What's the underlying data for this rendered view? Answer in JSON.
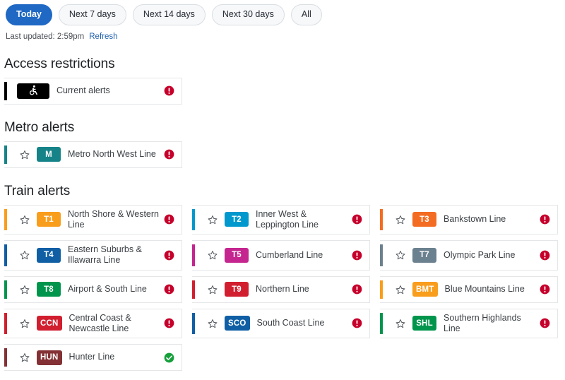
{
  "filters": {
    "items": [
      {
        "label": "Today",
        "active": true
      },
      {
        "label": "Next 7 days",
        "active": false
      },
      {
        "label": "Next 14 days",
        "active": false
      },
      {
        "label": "Next 30 days",
        "active": false
      },
      {
        "label": "All",
        "active": false
      }
    ]
  },
  "updated": {
    "text": "Last updated: 2:59pm",
    "refresh_label": "Refresh"
  },
  "sections": [
    {
      "title": "Access restrictions",
      "layout": "single",
      "items": [
        {
          "badge": "",
          "badge_icon": "wheelchair-icon",
          "label": "Current alerts",
          "color": "#000000",
          "status": "alert",
          "star": false
        }
      ]
    },
    {
      "title": "Metro alerts",
      "layout": "single",
      "items": [
        {
          "badge": "M",
          "label": "Metro North West Line",
          "color": "#168388",
          "status": "alert",
          "star": true
        }
      ]
    },
    {
      "title": "Train alerts",
      "layout": "grid",
      "items": [
        {
          "badge": "T1",
          "label": "North Shore & Western Line",
          "color": "#f99d1c",
          "status": "alert",
          "star": true
        },
        {
          "badge": "T2",
          "label": "Inner West & Leppington Line",
          "color": "#0098cd",
          "status": "alert",
          "star": true
        },
        {
          "badge": "T3",
          "label": "Bankstown Line",
          "color": "#f36c21",
          "status": "alert",
          "star": true
        },
        {
          "badge": "T4",
          "label": "Eastern Suburbs & Illawarra Line",
          "color": "#105fa5",
          "status": "alert",
          "star": true
        },
        {
          "badge": "T5",
          "label": "Cumberland Line",
          "color": "#c4258f",
          "status": "alert",
          "star": true
        },
        {
          "badge": "T7",
          "label": "Olympic Park Line",
          "color": "#6c818f",
          "status": "alert",
          "star": true
        },
        {
          "badge": "T8",
          "label": "Airport & South Line",
          "color": "#00954c",
          "status": "alert",
          "star": true
        },
        {
          "badge": "T9",
          "label": "Northern Line",
          "color": "#d11f2f",
          "status": "alert",
          "star": true
        },
        {
          "badge": "BMT",
          "label": "Blue Mountains Line",
          "color": "#f99d1c",
          "status": "alert",
          "star": true
        },
        {
          "badge": "CCN",
          "label": "Central Coast & Newcastle Line",
          "color": "#d11f2f",
          "status": "alert",
          "star": true
        },
        {
          "badge": "SCO",
          "label": "South Coast Line",
          "color": "#105fa5",
          "status": "alert",
          "star": true
        },
        {
          "badge": "SHL",
          "label": "Southern Highlands Line",
          "color": "#00954c",
          "status": "alert",
          "star": true
        },
        {
          "badge": "HUN",
          "label": "Hunter Line",
          "color": "#833134",
          "status": "ok",
          "star": true
        }
      ]
    }
  ],
  "icons": {
    "alert_color": "#c6002b",
    "ok_color": "#15a03a",
    "star_color": "#52585e"
  }
}
